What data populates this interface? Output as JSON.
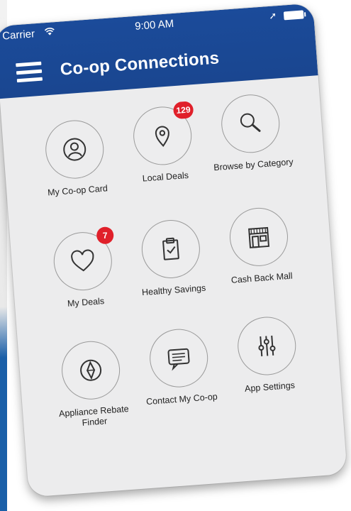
{
  "status_bar": {
    "carrier": "Carrier",
    "time": "9:00 AM"
  },
  "header": {
    "title": "Co-op Connections"
  },
  "tiles": [
    {
      "label": "My Co-op Card",
      "icon": "user-icon",
      "badge": ""
    },
    {
      "label": "Local Deals",
      "icon": "location-pin-icon",
      "badge": "129"
    },
    {
      "label": "Browse by Category",
      "icon": "search-icon",
      "badge": ""
    },
    {
      "label": "My Deals",
      "icon": "heart-icon",
      "badge": "7"
    },
    {
      "label": "Healthy Savings",
      "icon": "clipboard-check-icon",
      "badge": ""
    },
    {
      "label": "Cash Back Mall",
      "icon": "storefront-icon",
      "badge": ""
    },
    {
      "label": "Appliance Rebate Finder",
      "icon": "compass-icon",
      "badge": ""
    },
    {
      "label": "Contact My Co-op",
      "icon": "chat-icon",
      "badge": ""
    },
    {
      "label": "App Settings",
      "icon": "sliders-icon",
      "badge": ""
    }
  ],
  "colors": {
    "header_blue": "#1b4b9a",
    "badge_red": "#e0202a",
    "background": "#ececed"
  }
}
